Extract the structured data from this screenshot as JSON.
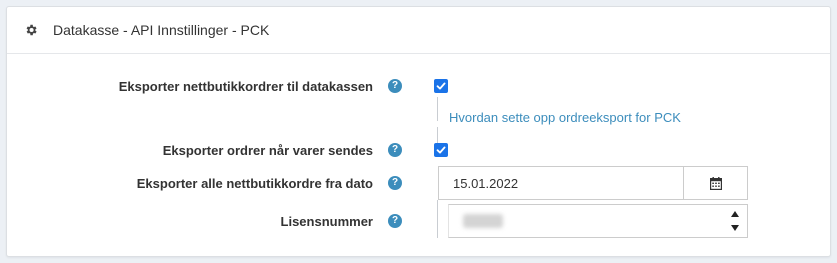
{
  "panel": {
    "title": "Datakasse - API Innstillinger - PCK",
    "icon": "gear-icon"
  },
  "fields": {
    "export_orders": {
      "label": "Eksporter nettbutikkordrer til datakassen",
      "checked": true,
      "help_link": "Hvordan sette opp ordreeksport for PCK"
    },
    "export_on_ship": {
      "label": "Eksporter ordrer når varer sendes",
      "checked": true
    },
    "export_from_date": {
      "label": "Eksporter alle nettbutikkordre fra dato",
      "value": "15.01.2022"
    },
    "license_number": {
      "label": "Lisensnummer"
    }
  },
  "help_glyph": "?",
  "colors": {
    "accent": "#3c8dbc",
    "checkbox": "#1a73e8"
  }
}
